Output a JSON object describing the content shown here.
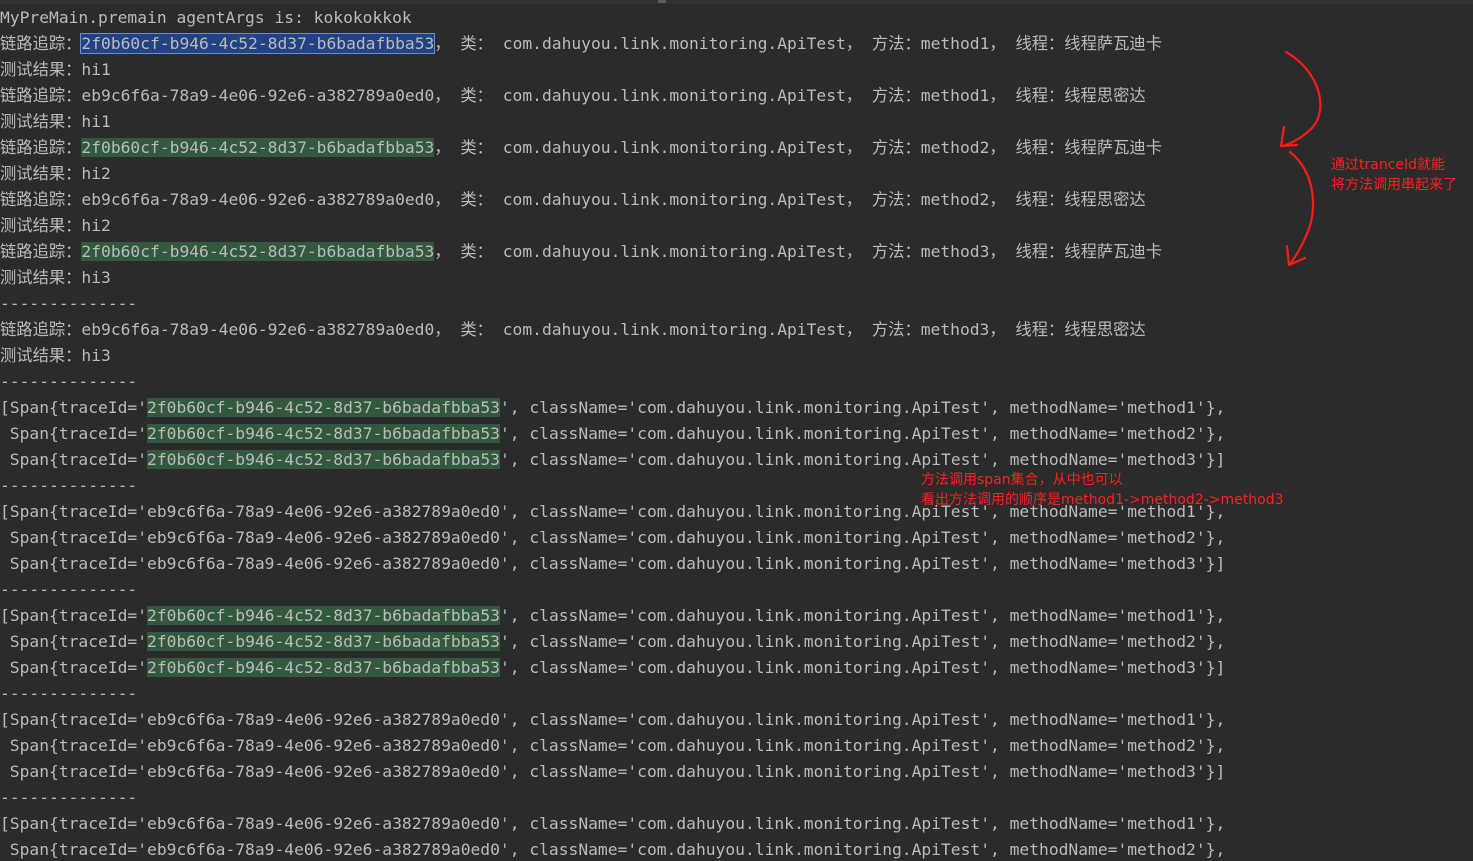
{
  "colors": {
    "background": "#2b2b2b",
    "text": "#bbbbbb",
    "selection_highlight": "#214283",
    "match_highlight": "#32593d",
    "annotation": "#ff2020"
  },
  "console": {
    "lines": [
      {
        "segments": [
          {
            "text": "MyPreMain.premain agentArgs is: kokokokkok"
          }
        ]
      },
      {
        "segments": [
          {
            "text": "链路追踪："
          },
          {
            "text": "2f0b60cf-b946-4c52-8d37-b6badafbba53",
            "hl": "blue"
          },
          {
            "text": "， 类： com.dahuyou.link.monitoring.ApiTest， 方法：method1， 线程：线程萨瓦迪卡"
          }
        ]
      },
      {
        "segments": [
          {
            "text": "测试结果：hi1"
          }
        ]
      },
      {
        "segments": [
          {
            "text": "链路追踪：eb9c6f6a-78a9-4e06-92e6-a382789a0ed0， 类： com.dahuyou.link.monitoring.ApiTest， 方法：method1， 线程：线程思密达"
          }
        ]
      },
      {
        "segments": [
          {
            "text": "测试结果：hi1"
          }
        ]
      },
      {
        "segments": [
          {
            "text": "链路追踪："
          },
          {
            "text": "2f0b60cf-b946-4c52-8d37-b6badafbba53",
            "hl": "green"
          },
          {
            "text": "， 类： com.dahuyou.link.monitoring.ApiTest， 方法：method2， 线程：线程萨瓦迪卡"
          }
        ]
      },
      {
        "segments": [
          {
            "text": "测试结果：hi2"
          }
        ]
      },
      {
        "segments": [
          {
            "text": "链路追踪：eb9c6f6a-78a9-4e06-92e6-a382789a0ed0， 类： com.dahuyou.link.monitoring.ApiTest， 方法：method2， 线程：线程思密达"
          }
        ]
      },
      {
        "segments": [
          {
            "text": "测试结果：hi2"
          }
        ]
      },
      {
        "segments": [
          {
            "text": "链路追踪："
          },
          {
            "text": "2f0b60cf-b946-4c52-8d37-b6badafbba53",
            "hl": "green"
          },
          {
            "text": "， 类： com.dahuyou.link.monitoring.ApiTest， 方法：method3， 线程：线程萨瓦迪卡"
          }
        ]
      },
      {
        "segments": [
          {
            "text": "测试结果：hi3"
          }
        ]
      },
      {
        "segments": [
          {
            "text": "--------------"
          }
        ]
      },
      {
        "segments": [
          {
            "text": "链路追踪：eb9c6f6a-78a9-4e06-92e6-a382789a0ed0， 类： com.dahuyou.link.monitoring.ApiTest， 方法：method3， 线程：线程思密达"
          }
        ]
      },
      {
        "segments": [
          {
            "text": "测试结果：hi3"
          }
        ]
      },
      {
        "segments": [
          {
            "text": "--------------"
          }
        ]
      },
      {
        "segments": [
          {
            "text": "[Span{traceId='"
          },
          {
            "text": "2f0b60cf-b946-4c52-8d37-b6badafbba53",
            "hl": "green"
          },
          {
            "text": "', className='com.dahuyou.link.monitoring.ApiTest', methodName='method1'},"
          }
        ]
      },
      {
        "segments": [
          {
            "text": " Span{traceId='"
          },
          {
            "text": "2f0b60cf-b946-4c52-8d37-b6badafbba53",
            "hl": "green"
          },
          {
            "text": "', className='com.dahuyou.link.monitoring.ApiTest', methodName='method2'},"
          }
        ]
      },
      {
        "segments": [
          {
            "text": " Span{traceId='"
          },
          {
            "text": "2f0b60cf-b946-4c52-8d37-b6badafbba53",
            "hl": "green"
          },
          {
            "text": "', className='com.dahuyou.link.monitoring.ApiTest', methodName='method3'}]"
          }
        ]
      },
      {
        "segments": [
          {
            "text": "--------------"
          }
        ]
      },
      {
        "segments": [
          {
            "text": "[Span{traceId='eb9c6f6a-78a9-4e06-92e6-a382789a0ed0', className='com.dahuyou.link.monitoring.ApiTest', methodName='method1'},"
          }
        ]
      },
      {
        "segments": [
          {
            "text": " Span{traceId='eb9c6f6a-78a9-4e06-92e6-a382789a0ed0', className='com.dahuyou.link.monitoring.ApiTest', methodName='method2'},"
          }
        ]
      },
      {
        "segments": [
          {
            "text": " Span{traceId='eb9c6f6a-78a9-4e06-92e6-a382789a0ed0', className='com.dahuyou.link.monitoring.ApiTest', methodName='method3'}]"
          }
        ]
      },
      {
        "segments": [
          {
            "text": "--------------"
          }
        ]
      },
      {
        "segments": [
          {
            "text": "[Span{traceId='"
          },
          {
            "text": "2f0b60cf-b946-4c52-8d37-b6badafbba53",
            "hl": "green"
          },
          {
            "text": "', className='com.dahuyou.link.monitoring.ApiTest', methodName='method1'},"
          }
        ]
      },
      {
        "segments": [
          {
            "text": " Span{traceId='"
          },
          {
            "text": "2f0b60cf-b946-4c52-8d37-b6badafbba53",
            "hl": "green"
          },
          {
            "text": "', className='com.dahuyou.link.monitoring.ApiTest', methodName='method2'},"
          }
        ]
      },
      {
        "segments": [
          {
            "text": " Span{traceId='"
          },
          {
            "text": "2f0b60cf-b946-4c52-8d37-b6badafbba53",
            "hl": "green"
          },
          {
            "text": "', className='com.dahuyou.link.monitoring.ApiTest', methodName='method3'}]"
          }
        ]
      },
      {
        "segments": [
          {
            "text": "--------------"
          }
        ]
      },
      {
        "segments": [
          {
            "text": "[Span{traceId='eb9c6f6a-78a9-4e06-92e6-a382789a0ed0', className='com.dahuyou.link.monitoring.ApiTest', methodName='method1'},"
          }
        ]
      },
      {
        "segments": [
          {
            "text": " Span{traceId='eb9c6f6a-78a9-4e06-92e6-a382789a0ed0', className='com.dahuyou.link.monitoring.ApiTest', methodName='method2'},"
          }
        ]
      },
      {
        "segments": [
          {
            "text": " Span{traceId='eb9c6f6a-78a9-4e06-92e6-a382789a0ed0', className='com.dahuyou.link.monitoring.ApiTest', methodName='method3'}]"
          }
        ]
      },
      {
        "segments": [
          {
            "text": "--------------"
          }
        ]
      },
      {
        "segments": [
          {
            "text": "[Span{traceId='eb9c6f6a-78a9-4e06-92e6-a382789a0ed0', className='com.dahuyou.link.monitoring.ApiTest', methodName='method1'},"
          }
        ]
      },
      {
        "segments": [
          {
            "text": " Span{traceId='eb9c6f6a-78a9-4e06-92e6-a382789a0ed0', className='com.dahuyou.link.monitoring.ApiTest', methodName='method2'},"
          }
        ]
      }
    ]
  },
  "annotations": {
    "traceid_note": "通过tranceId就能\n将方法调用串起来了",
    "span_note": "方法调用span集合，从中也可以\n看出方法调用的顺序是method1->method2->method3"
  }
}
